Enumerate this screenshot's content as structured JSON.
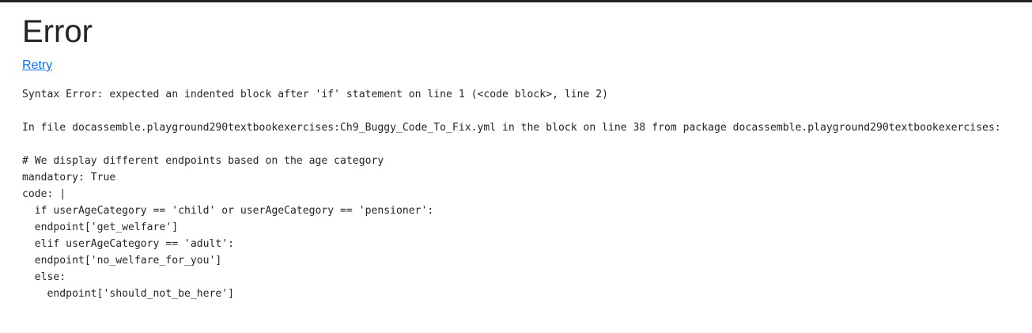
{
  "page": {
    "title": "Error",
    "retry_label": "Retry"
  },
  "error": {
    "message": "Syntax Error: expected an indented block after 'if' statement on line 1 (<code block>, line 2)",
    "location": "In file docassemble.playground290textbookexercises:Ch9_Buggy_Code_To_Fix.yml in the block on line 38 from package docassemble.playground290textbookexercises:",
    "code_lines": [
      "# We display different endpoints based on the age category",
      "mandatory: True",
      "code: |",
      "  if userAgeCategory == 'child' or userAgeCategory == 'pensioner':",
      "  endpoint['get_welfare']",
      "  elif userAgeCategory == 'adult':",
      "  endpoint['no_welfare_for_you']",
      "  else:",
      "    endpoint['should_not_be_here']"
    ]
  }
}
